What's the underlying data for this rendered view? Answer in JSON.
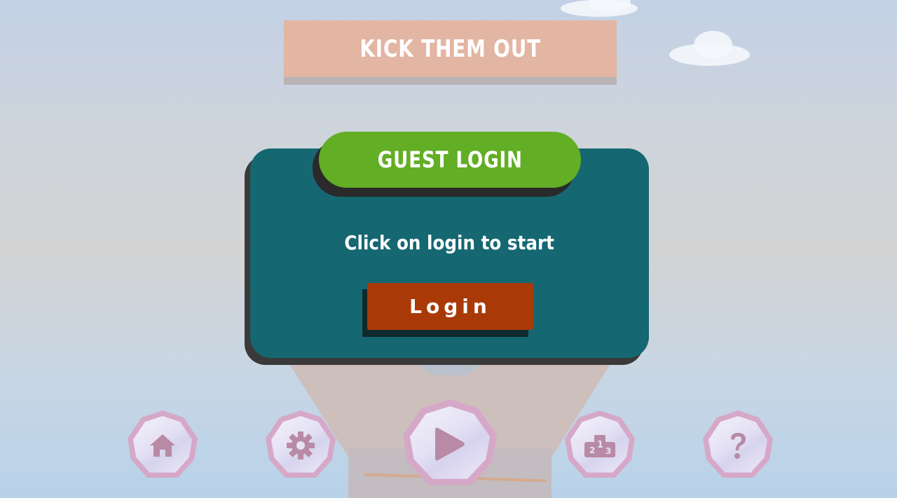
{
  "title": "KICK THEM OUT",
  "panel": {
    "header": "GUEST LOGIN",
    "message": "Click on login to start",
    "login_label": "Login"
  },
  "nav": {
    "items": [
      {
        "id": "home",
        "icon": "home-icon"
      },
      {
        "id": "settings",
        "icon": "gear-icon"
      },
      {
        "id": "play",
        "icon": "play-icon"
      },
      {
        "id": "leaderboard",
        "icon": "podium-icon",
        "icon_text": "213"
      },
      {
        "id": "help",
        "icon": "question-icon"
      }
    ]
  },
  "colors": {
    "panel": "#156772",
    "guest_header": "#62ae24",
    "login_button": "#a93a08",
    "title_banner": "#e3b5a3",
    "gem_border": "#d6a8c8",
    "icon": "#b88aa6"
  }
}
